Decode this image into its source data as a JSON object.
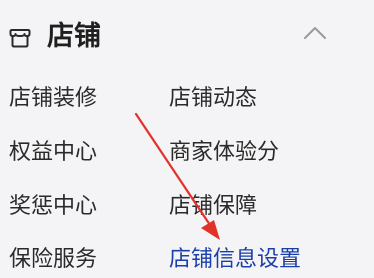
{
  "section": {
    "title": "店铺",
    "icon": "store-icon",
    "collapse_icon": "chevron-up-icon"
  },
  "menu": {
    "left": [
      "店铺装修",
      "权益中心",
      "奖惩中心",
      "保险服务"
    ],
    "right": [
      "店铺动态",
      "商家体验分",
      "店铺保障",
      "店铺信息设置"
    ]
  },
  "colors": {
    "background": "#f4f4f6",
    "text": "#2a2a2a",
    "active": "#1a3fa8",
    "annotation_arrow": "#e0322a"
  }
}
